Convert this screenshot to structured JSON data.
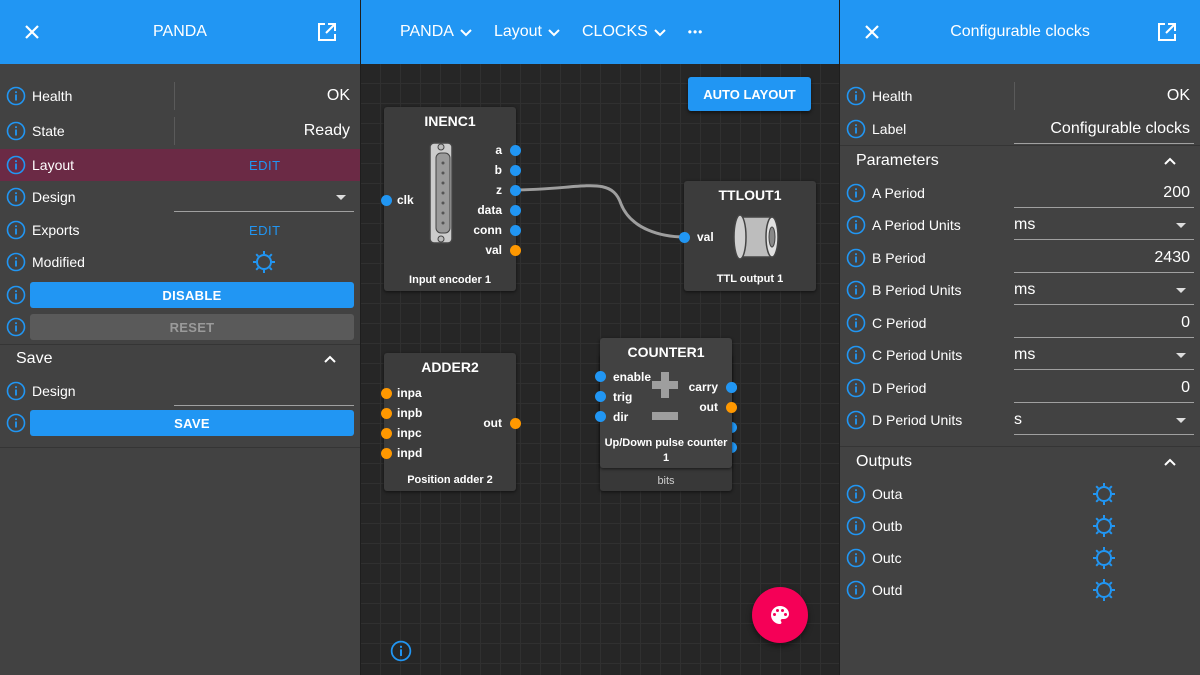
{
  "left": {
    "title": "PANDA",
    "rows": {
      "health_label": "Health",
      "health_value": "OK",
      "state_label": "State",
      "state_value": "Ready",
      "layout_label": "Layout",
      "layout_action": "EDIT",
      "design_label": "Design",
      "design_value": "",
      "exports_label": "Exports",
      "exports_action": "EDIT",
      "modified_label": "Modified"
    },
    "disable_button": "DISABLE",
    "reset_button": "RESET",
    "save_section": {
      "title": "Save",
      "design_label": "Design",
      "design_value": "",
      "save_button": "SAVE"
    }
  },
  "middle": {
    "menu": [
      "PANDA",
      "Layout",
      "CLOCKS"
    ],
    "more": "•••",
    "auto_layout": "AUTO LAYOUT",
    "blocks": {
      "inenc": {
        "title": "INENC1",
        "desc": "Input encoder 1",
        "inputs": [
          "clk"
        ],
        "outputs": [
          "a",
          "b",
          "z",
          "data",
          "conn",
          "val"
        ]
      },
      "ttlout": {
        "title": "TTLOUT1",
        "desc": "TTL output 1",
        "inputs": [
          "val"
        ]
      },
      "adder": {
        "title": "ADDER2",
        "desc": "Position adder 2",
        "inputs": [
          "inpa",
          "inpb",
          "inpc",
          "inpd"
        ],
        "outputs": [
          "out"
        ]
      },
      "counter": {
        "title": "COUNTER1",
        "desc": "Up/Down pulse counter 1",
        "inputs": [
          "enable",
          "trig",
          "dir"
        ],
        "outputs": [
          "carry",
          "out"
        ],
        "behind_desc": "bits"
      }
    }
  },
  "right": {
    "title": "Configurable clocks",
    "health_label": "Health",
    "health_value": "OK",
    "label_label": "Label",
    "label_value": "Configurable clocks",
    "parameters": {
      "title": "Parameters",
      "a_period_label": "A Period",
      "a_period_value": "200",
      "a_units_label": "A Period Units",
      "a_units_value": "ms",
      "b_period_label": "B Period",
      "b_period_value": "2430",
      "b_units_label": "B Period Units",
      "b_units_value": "ms",
      "c_period_label": "C Period",
      "c_period_value": "0",
      "c_units_label": "C Period Units",
      "c_units_value": "ms",
      "d_period_label": "D Period",
      "d_period_value": "0",
      "d_units_label": "D Period Units",
      "d_units_value": "s"
    },
    "outputs": {
      "title": "Outputs",
      "items": [
        "Outa",
        "Outb",
        "Outc",
        "Outd"
      ]
    }
  },
  "colors": {
    "primary": "#2196f3",
    "accent": "#f50057",
    "port_bit": "#2196f3",
    "port_pos": "#ff9800",
    "selected_row": "#6b2a45"
  }
}
